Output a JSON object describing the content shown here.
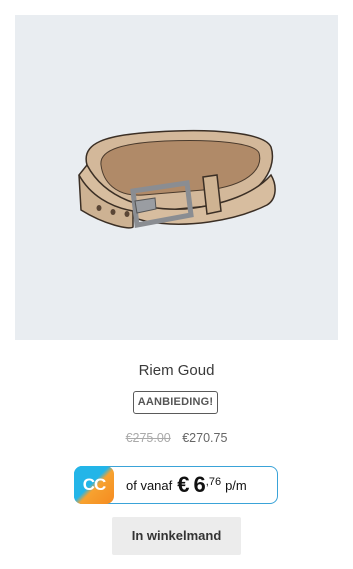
{
  "product": {
    "name": "Riem Goud",
    "badge": "AANBIEDING!",
    "old_price": "€275.00",
    "new_price": "€270.75",
    "image_alt": "belt"
  },
  "credit": {
    "logo_text": "CC",
    "prefix": "of vanaf",
    "currency": "€",
    "amount": "6",
    "cents": ",76",
    "suffix": "p/m",
    "border_color": "#3aa3d8"
  },
  "actions": {
    "add_to_cart_label": "In winkelmand"
  }
}
